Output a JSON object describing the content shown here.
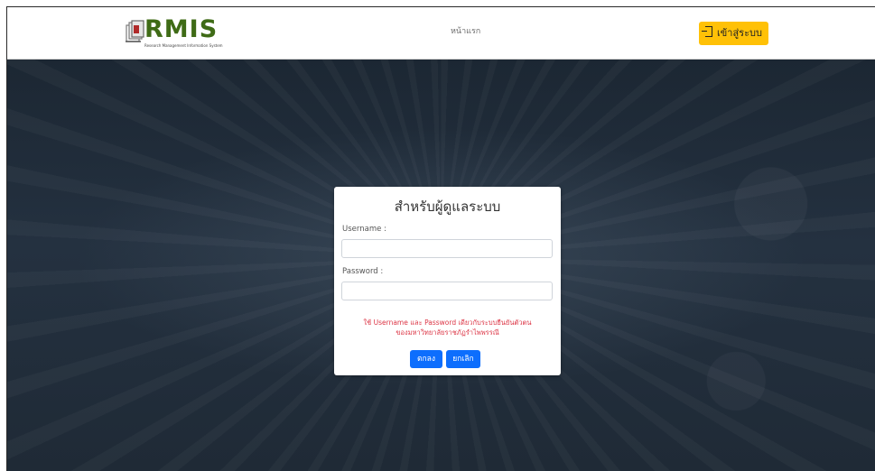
{
  "header": {
    "logo_text": "RMIS",
    "logo_subtitle": "Research Management Information System",
    "nav_home_label": "หน้าแรก",
    "login_button_label": "เข้าสู่ระบบ",
    "login_button_icon": "login-icon"
  },
  "login_form": {
    "title": "สำหรับผู้ดูแลระบบ",
    "username_label": "Username :",
    "username_value": "",
    "password_label": "Password :",
    "password_value": "",
    "notice_line1": "ใช้ Username และ Password เดียวกับระบบยืนยันตัวตน",
    "notice_line2": "ของมหาวิทยาลัยราชภัฏรำไพพรรณี",
    "submit_label": "ตกลง",
    "cancel_label": "ยกเลิก"
  },
  "colors": {
    "brand_green": "#3f6b16",
    "accent_yellow": "#ffc107",
    "primary_blue": "#0d6efd",
    "notice_red": "#dc3545",
    "hero_dark": "#1f2a36"
  }
}
